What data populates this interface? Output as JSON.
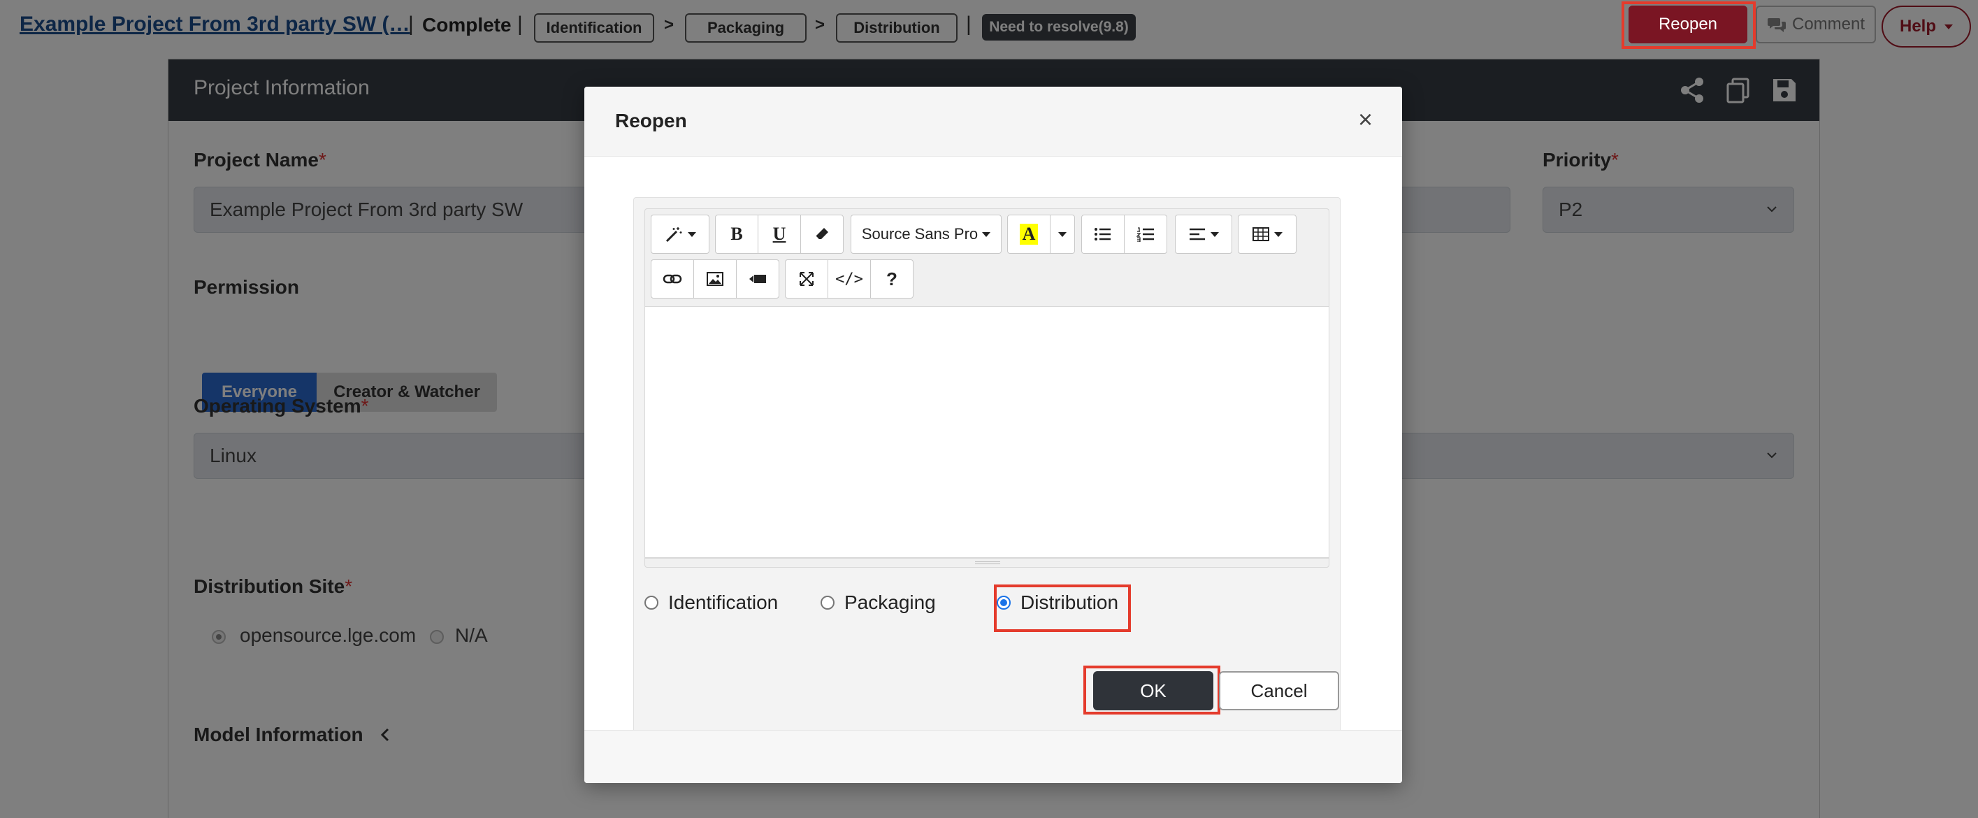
{
  "topbar": {
    "project_title": "Example Project From 3rd party SW (…",
    "separator": "|",
    "status": "Complete",
    "steps": [
      "Identification",
      "Packaging",
      "Distribution"
    ],
    "step_arrow": ">",
    "resolve_badge": "Need to resolve(9.8)",
    "reopen_label": "Reopen",
    "comment_label": "Comment",
    "help_label": "Help"
  },
  "panel": {
    "title": "Project Information",
    "header_icons": [
      "share-icon",
      "copy-icon",
      "save-icon"
    ],
    "project_name_label": "Project Name",
    "project_name_value": "Example Project From 3rd party SW",
    "priority_label": "Priority",
    "priority_value": "P2",
    "permission_label": "Permission",
    "permission_options": [
      "Everyone",
      "Creator & Watcher"
    ],
    "os_label": "Operating System",
    "os_value": "Linux",
    "distribution_site_label": "Distribution Site",
    "distribution_site_options": [
      "opensource.lge.com",
      "N/A"
    ],
    "model_info_label": "Model Information",
    "required_mark": "*"
  },
  "modal": {
    "title": "Reopen",
    "close_glyph": "×",
    "toolbar": {
      "font_name": "Source Sans Pro",
      "bold": "B",
      "underline": "U",
      "code_glyph": "</>",
      "help_glyph": "?",
      "highlight_glyph": "A"
    },
    "editor_content": "",
    "radio_options": [
      "Identification",
      "Packaging",
      "Distribution"
    ],
    "selected_option": "Distribution",
    "ok_label": "OK",
    "cancel_label": "Cancel"
  },
  "colors": {
    "accent_highlight": "#e43b2c",
    "reopen_bg": "#7a1523",
    "header_bg": "#373c44",
    "selected_blue": "#1a73e8"
  }
}
